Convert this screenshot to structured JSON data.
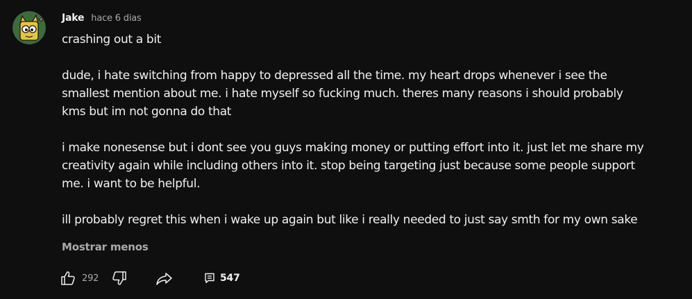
{
  "comment": {
    "author": "Jake",
    "time": "hace 6 dias",
    "lines": [
      "crashing out a bit",
      "",
      "dude, i hate switching from happy to depressed all the time. my heart drops whenever i see the",
      "smallest mention about me. i hate myself so fucking much. theres many reasons i should probably",
      "kms but im not gonna do that",
      "",
      "i make nonesense but i dont see you guys making money or putting effort into it. just let me share my",
      "creativity again while including others into it. stop being targeting just because some people support",
      "me. i want to be helpful.",
      "",
      "ill probably regret this when i wake up again but like i really needed to just say smth for my own sake"
    ],
    "show_less_label": "Mostrar menos",
    "like_count": "292",
    "reply_count": "547"
  },
  "colors": {
    "background": "#0f0f0f",
    "text_primary": "#f1f1f1",
    "text_secondary": "#aaaaaa",
    "avatar_bg": "#3c6b3c"
  },
  "icons": {
    "like": "thumbs-up-icon",
    "dislike": "thumbs-down-icon",
    "share": "share-arrow-icon",
    "replies": "comment-icon"
  }
}
